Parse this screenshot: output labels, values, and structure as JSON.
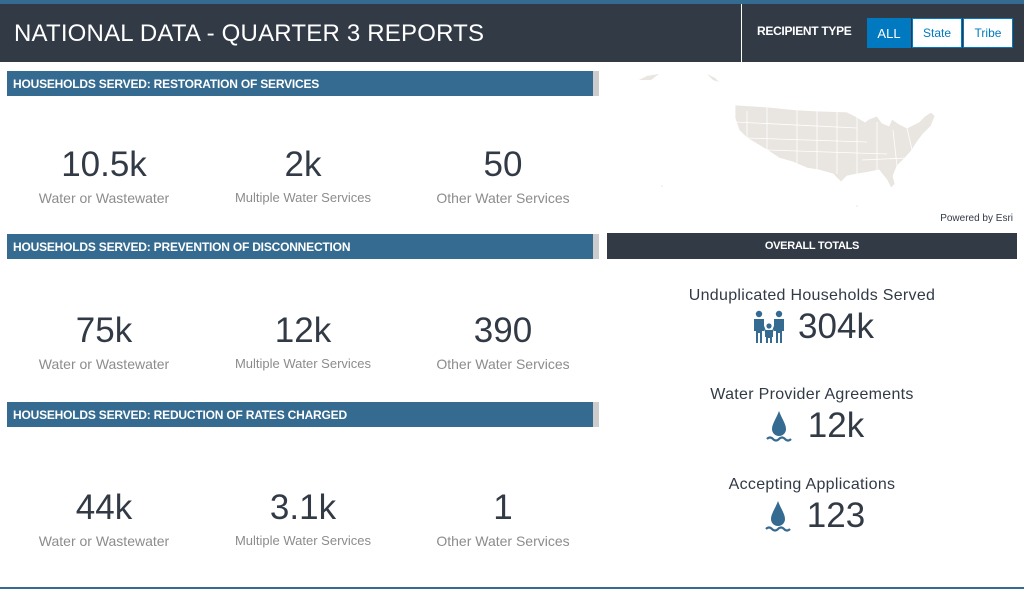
{
  "header": {
    "title": "NATIONAL DATA - QUARTER 3 REPORTS",
    "recipient_type_label": "RECIPIENT TYPE",
    "filters": [
      {
        "label": "ALL",
        "selected": true
      },
      {
        "label": "State",
        "selected": false
      },
      {
        "label": "Tribe",
        "selected": false
      }
    ]
  },
  "sections": [
    {
      "title": "HOUSEHOLDS SERVED: RESTORATION OF SERVICES",
      "stats": [
        {
          "value": "10.5k",
          "label": "Water or Wastewater"
        },
        {
          "value": "2k",
          "label": "Multiple Water Services"
        },
        {
          "value": "50",
          "label": "Other Water Services"
        }
      ]
    },
    {
      "title": "HOUSEHOLDS SERVED: PREVENTION OF DISCONNECTION",
      "stats": [
        {
          "value": "75k",
          "label": "Water or Wastewater"
        },
        {
          "value": "12k",
          "label": "Multiple Water Services"
        },
        {
          "value": "390",
          "label": "Other Water Services"
        }
      ]
    },
    {
      "title": "HOUSEHOLDS SERVED: REDUCTION OF RATES CHARGED",
      "stats": [
        {
          "value": "44k",
          "label": "Water or Wastewater"
        },
        {
          "value": "3.1k",
          "label": "Multiple Water Services"
        },
        {
          "value": "1",
          "label": "Other Water Services"
        }
      ]
    }
  ],
  "map": {
    "credit": "Powered by Esri"
  },
  "totals": {
    "title": "OVERALL TOTALS",
    "items": [
      {
        "label": "Unduplicated Households Served",
        "value": "304k",
        "icon": "family-icon"
      },
      {
        "label": "Water Provider Agreements",
        "value": "12k",
        "icon": "water-drop-icon"
      },
      {
        "label": "Accepting Applications",
        "value": "123",
        "icon": "water-drop-icon"
      }
    ]
  },
  "colors": {
    "header_bg": "#323a46",
    "section_bar": "#356b90",
    "accent": "#0079c1",
    "icon": "#356b90"
  }
}
